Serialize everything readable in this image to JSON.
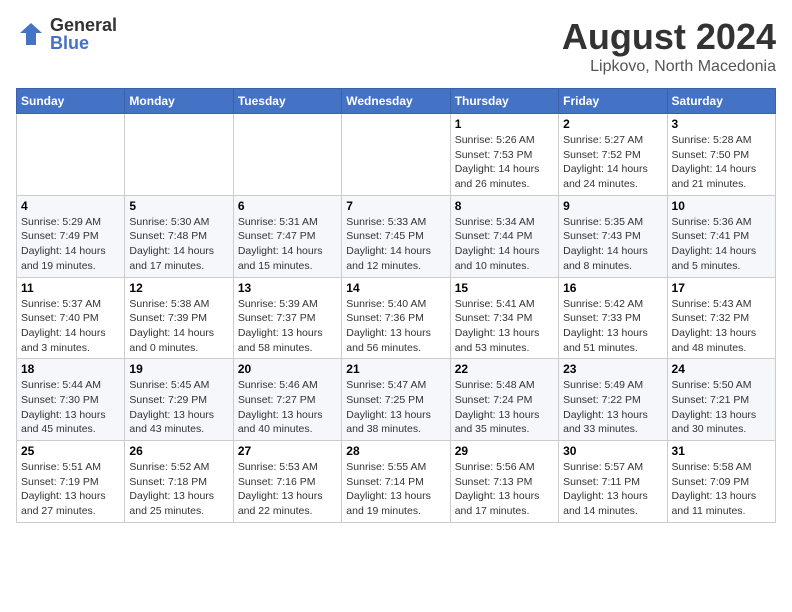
{
  "header": {
    "logo_general": "General",
    "logo_blue": "Blue",
    "month_year": "August 2024",
    "location": "Lipkovo, North Macedonia"
  },
  "weekdays": [
    "Sunday",
    "Monday",
    "Tuesday",
    "Wednesday",
    "Thursday",
    "Friday",
    "Saturday"
  ],
  "weeks": [
    [
      {
        "day": "",
        "info": ""
      },
      {
        "day": "",
        "info": ""
      },
      {
        "day": "",
        "info": ""
      },
      {
        "day": "",
        "info": ""
      },
      {
        "day": "1",
        "info": "Sunrise: 5:26 AM\nSunset: 7:53 PM\nDaylight: 14 hours\nand 26 minutes."
      },
      {
        "day": "2",
        "info": "Sunrise: 5:27 AM\nSunset: 7:52 PM\nDaylight: 14 hours\nand 24 minutes."
      },
      {
        "day": "3",
        "info": "Sunrise: 5:28 AM\nSunset: 7:50 PM\nDaylight: 14 hours\nand 21 minutes."
      }
    ],
    [
      {
        "day": "4",
        "info": "Sunrise: 5:29 AM\nSunset: 7:49 PM\nDaylight: 14 hours\nand 19 minutes."
      },
      {
        "day": "5",
        "info": "Sunrise: 5:30 AM\nSunset: 7:48 PM\nDaylight: 14 hours\nand 17 minutes."
      },
      {
        "day": "6",
        "info": "Sunrise: 5:31 AM\nSunset: 7:47 PM\nDaylight: 14 hours\nand 15 minutes."
      },
      {
        "day": "7",
        "info": "Sunrise: 5:33 AM\nSunset: 7:45 PM\nDaylight: 14 hours\nand 12 minutes."
      },
      {
        "day": "8",
        "info": "Sunrise: 5:34 AM\nSunset: 7:44 PM\nDaylight: 14 hours\nand 10 minutes."
      },
      {
        "day": "9",
        "info": "Sunrise: 5:35 AM\nSunset: 7:43 PM\nDaylight: 14 hours\nand 8 minutes."
      },
      {
        "day": "10",
        "info": "Sunrise: 5:36 AM\nSunset: 7:41 PM\nDaylight: 14 hours\nand 5 minutes."
      }
    ],
    [
      {
        "day": "11",
        "info": "Sunrise: 5:37 AM\nSunset: 7:40 PM\nDaylight: 14 hours\nand 3 minutes."
      },
      {
        "day": "12",
        "info": "Sunrise: 5:38 AM\nSunset: 7:39 PM\nDaylight: 14 hours\nand 0 minutes."
      },
      {
        "day": "13",
        "info": "Sunrise: 5:39 AM\nSunset: 7:37 PM\nDaylight: 13 hours\nand 58 minutes."
      },
      {
        "day": "14",
        "info": "Sunrise: 5:40 AM\nSunset: 7:36 PM\nDaylight: 13 hours\nand 56 minutes."
      },
      {
        "day": "15",
        "info": "Sunrise: 5:41 AM\nSunset: 7:34 PM\nDaylight: 13 hours\nand 53 minutes."
      },
      {
        "day": "16",
        "info": "Sunrise: 5:42 AM\nSunset: 7:33 PM\nDaylight: 13 hours\nand 51 minutes."
      },
      {
        "day": "17",
        "info": "Sunrise: 5:43 AM\nSunset: 7:32 PM\nDaylight: 13 hours\nand 48 minutes."
      }
    ],
    [
      {
        "day": "18",
        "info": "Sunrise: 5:44 AM\nSunset: 7:30 PM\nDaylight: 13 hours\nand 45 minutes."
      },
      {
        "day": "19",
        "info": "Sunrise: 5:45 AM\nSunset: 7:29 PM\nDaylight: 13 hours\nand 43 minutes."
      },
      {
        "day": "20",
        "info": "Sunrise: 5:46 AM\nSunset: 7:27 PM\nDaylight: 13 hours\nand 40 minutes."
      },
      {
        "day": "21",
        "info": "Sunrise: 5:47 AM\nSunset: 7:25 PM\nDaylight: 13 hours\nand 38 minutes."
      },
      {
        "day": "22",
        "info": "Sunrise: 5:48 AM\nSunset: 7:24 PM\nDaylight: 13 hours\nand 35 minutes."
      },
      {
        "day": "23",
        "info": "Sunrise: 5:49 AM\nSunset: 7:22 PM\nDaylight: 13 hours\nand 33 minutes."
      },
      {
        "day": "24",
        "info": "Sunrise: 5:50 AM\nSunset: 7:21 PM\nDaylight: 13 hours\nand 30 minutes."
      }
    ],
    [
      {
        "day": "25",
        "info": "Sunrise: 5:51 AM\nSunset: 7:19 PM\nDaylight: 13 hours\nand 27 minutes."
      },
      {
        "day": "26",
        "info": "Sunrise: 5:52 AM\nSunset: 7:18 PM\nDaylight: 13 hours\nand 25 minutes."
      },
      {
        "day": "27",
        "info": "Sunrise: 5:53 AM\nSunset: 7:16 PM\nDaylight: 13 hours\nand 22 minutes."
      },
      {
        "day": "28",
        "info": "Sunrise: 5:55 AM\nSunset: 7:14 PM\nDaylight: 13 hours\nand 19 minutes."
      },
      {
        "day": "29",
        "info": "Sunrise: 5:56 AM\nSunset: 7:13 PM\nDaylight: 13 hours\nand 17 minutes."
      },
      {
        "day": "30",
        "info": "Sunrise: 5:57 AM\nSunset: 7:11 PM\nDaylight: 13 hours\nand 14 minutes."
      },
      {
        "day": "31",
        "info": "Sunrise: 5:58 AM\nSunset: 7:09 PM\nDaylight: 13 hours\nand 11 minutes."
      }
    ]
  ]
}
